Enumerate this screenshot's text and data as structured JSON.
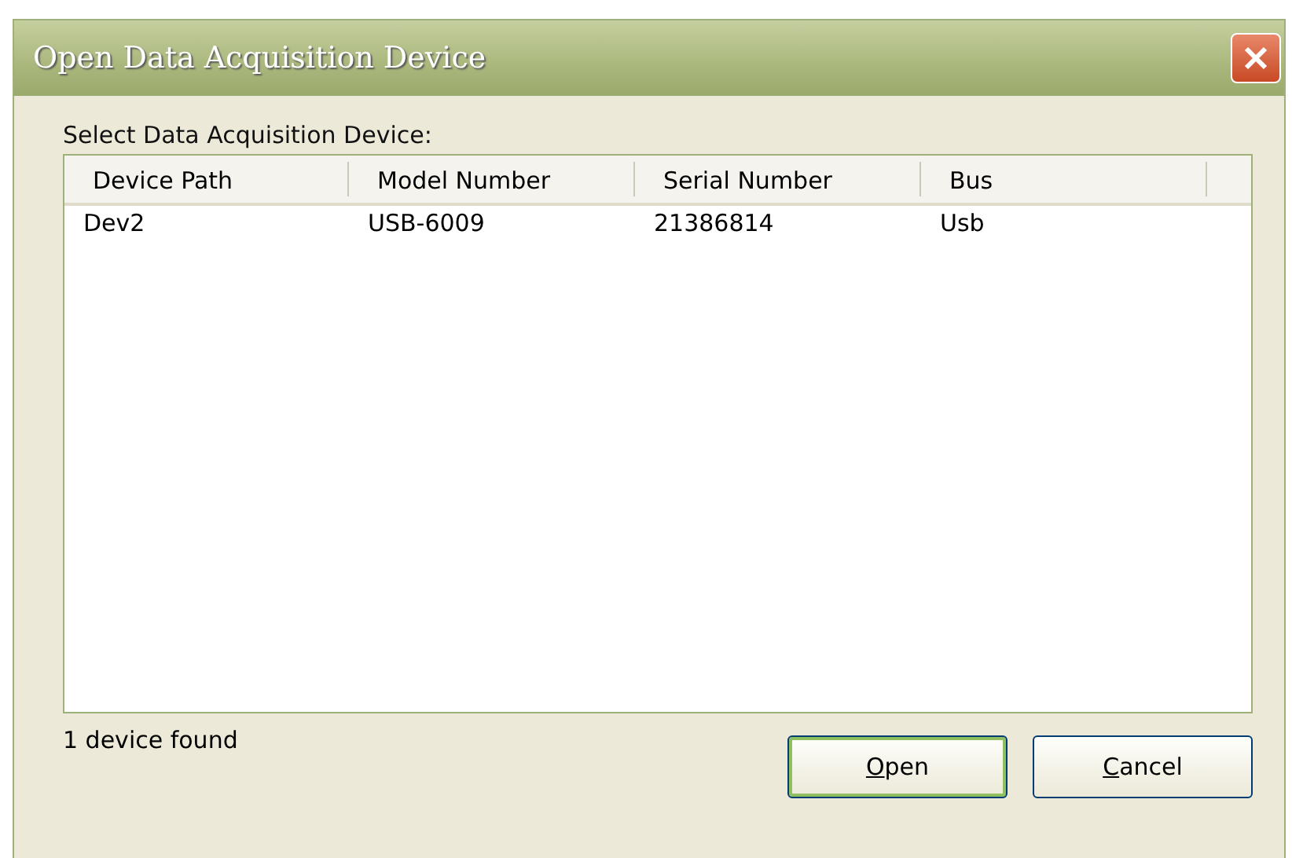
{
  "window": {
    "title": "Open Data Acquisition Device"
  },
  "list_label": "Select Data Acquisition Device:",
  "table": {
    "columns": [
      "Device Path",
      "Model Number",
      "Serial Number",
      "Bus"
    ],
    "rows": [
      {
        "cells": [
          "Dev2",
          "USB-6009",
          "21386814",
          "Usb"
        ],
        "selected": false
      }
    ]
  },
  "status": "1 device found",
  "buttons": [
    {
      "access_key": "O",
      "label_rest": "pen",
      "default": true
    },
    {
      "access_key": "C",
      "label_rest": "ancel",
      "default": false
    }
  ]
}
